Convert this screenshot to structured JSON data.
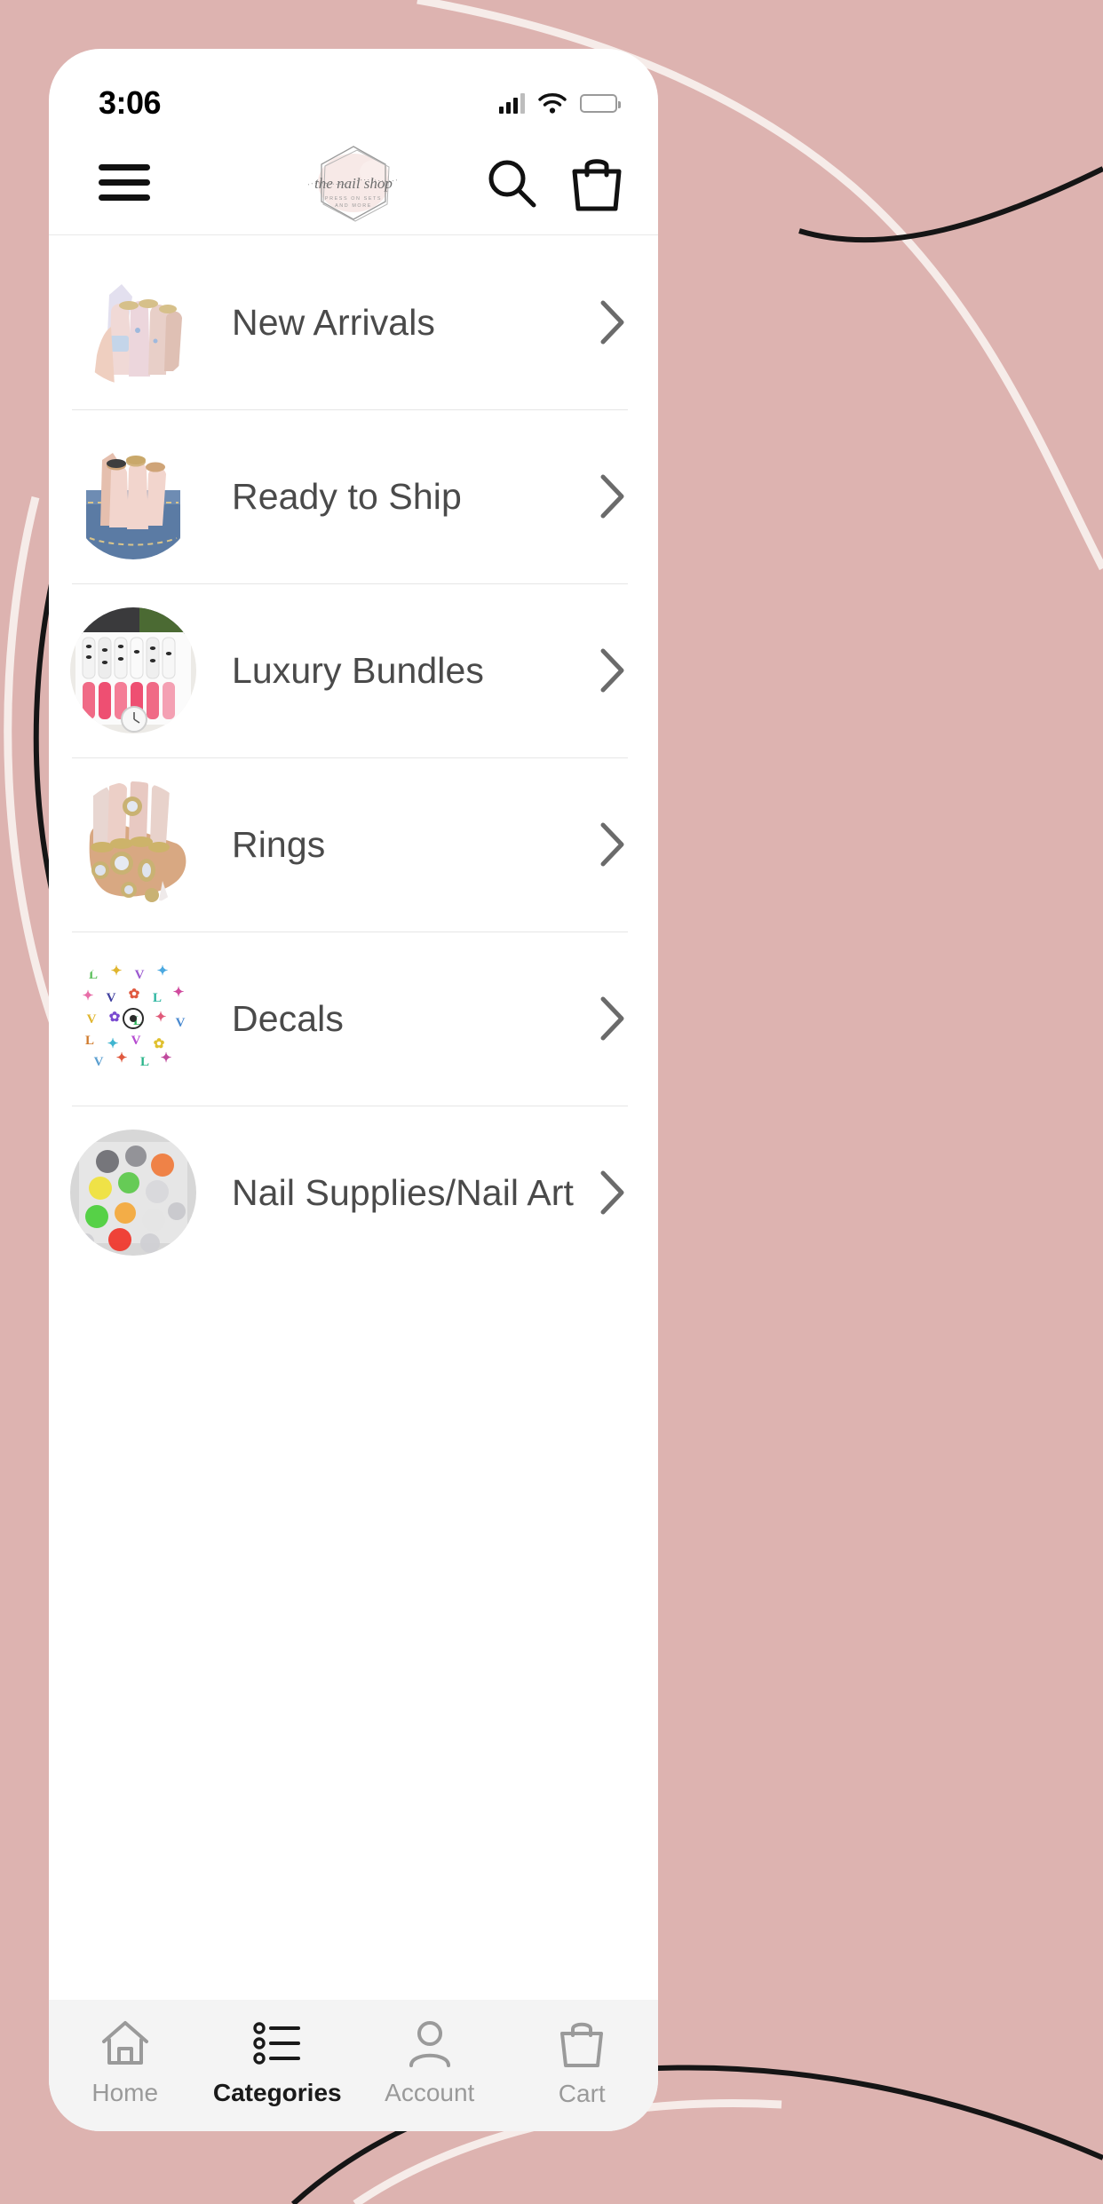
{
  "theme": {
    "background_pink": "#ddb3b0",
    "phone_bg": "#ffffff",
    "tabbar_bg": "#f4f4f4",
    "label_color": "#4a4a4a",
    "inactive_tab_color": "#9a9a9a",
    "active_tab_color": "#1a1a1a",
    "battery_color": "#e8402a"
  },
  "status_bar": {
    "time": "3:06",
    "signal_icon": "cellular-signal-icon",
    "wifi_icon": "wifi-icon",
    "battery_icon": "battery-low-icon"
  },
  "header": {
    "menu_icon": "hamburger-menu-icon",
    "logo": {
      "icon": "hexagon-logo",
      "brand": "the nail shop",
      "tagline": "PRESS ON SETS",
      "tagline2": "AND MORE"
    },
    "search_icon": "search-icon",
    "cart_icon": "shopping-bag-icon"
  },
  "categories": [
    {
      "label": "New Arrivals",
      "thumb": "nails-holographic-thumb",
      "chevron": "chevron-right-icon"
    },
    {
      "label": "Ready to Ship",
      "thumb": "nails-denim-pocket-thumb",
      "chevron": "chevron-right-icon"
    },
    {
      "label": "Luxury Bundles",
      "thumb": "nail-bundle-tray-thumb",
      "chevron": "chevron-right-icon"
    },
    {
      "label": "Rings",
      "thumb": "hand-with-rings-thumb",
      "chevron": "chevron-right-icon"
    },
    {
      "label": "Decals",
      "thumb": "monogram-decals-thumb",
      "chevron": "chevron-right-icon"
    },
    {
      "label": "Nail Supplies/Nail Art",
      "thumb": "nail-art-palette-thumb",
      "chevron": "chevron-right-icon"
    }
  ],
  "tabbar": {
    "items": [
      {
        "label": "Home",
        "icon": "home-icon",
        "active": false
      },
      {
        "label": "Categories",
        "icon": "list-icon",
        "active": true
      },
      {
        "label": "Account",
        "icon": "person-icon",
        "active": false
      },
      {
        "label": "Cart",
        "icon": "shopping-bag-icon",
        "active": false
      }
    ]
  }
}
